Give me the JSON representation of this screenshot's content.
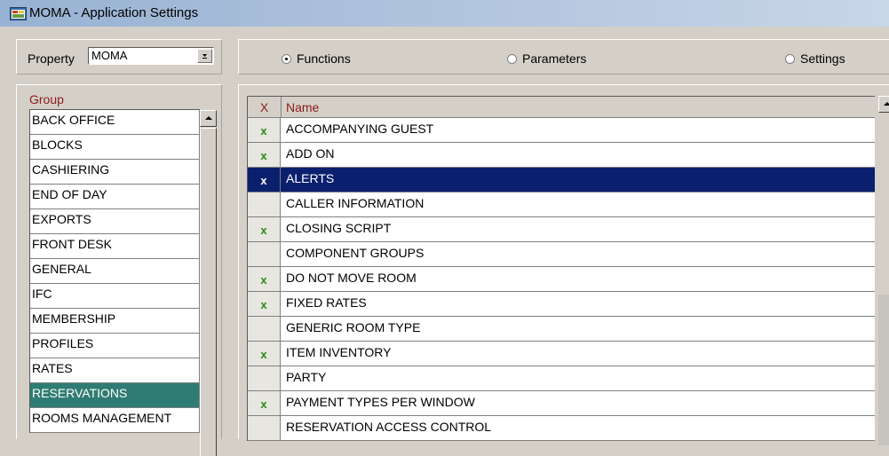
{
  "window": {
    "title": "MOMA - Application Settings",
    "icon": "app-window-icon"
  },
  "property": {
    "label": "Property",
    "value": "MOMA",
    "dropdown_icon": "dropdown-arrow-icon"
  },
  "modes": [
    {
      "label": "Functions",
      "selected": true
    },
    {
      "label": "Parameters",
      "selected": false
    },
    {
      "label": "Settings",
      "selected": false
    }
  ],
  "group": {
    "header": "Group",
    "items": [
      {
        "label": "BACK OFFICE",
        "selected": false
      },
      {
        "label": "BLOCKS",
        "selected": false
      },
      {
        "label": "CASHIERING",
        "selected": false
      },
      {
        "label": "END OF DAY",
        "selected": false
      },
      {
        "label": "EXPORTS",
        "selected": false
      },
      {
        "label": "FRONT DESK",
        "selected": false
      },
      {
        "label": "GENERAL",
        "selected": false
      },
      {
        "label": "IFC",
        "selected": false
      },
      {
        "label": "MEMBERSHIP",
        "selected": false
      },
      {
        "label": "PROFILES",
        "selected": false
      },
      {
        "label": "RATES",
        "selected": false
      },
      {
        "label": "RESERVATIONS",
        "selected": true
      },
      {
        "label": "ROOMS MANAGEMENT",
        "selected": false
      }
    ]
  },
  "functions": {
    "columns": {
      "x": "X",
      "name": "Name"
    },
    "rows": [
      {
        "active": "x",
        "name": "ACCOMPANYING GUEST",
        "selected": false
      },
      {
        "active": "x",
        "name": "ADD ON",
        "selected": false
      },
      {
        "active": "x",
        "name": "ALERTS",
        "selected": true
      },
      {
        "active": "",
        "name": "CALLER INFORMATION",
        "selected": false
      },
      {
        "active": "x",
        "name": "CLOSING SCRIPT",
        "selected": false
      },
      {
        "active": "",
        "name": "COMPONENT GROUPS",
        "selected": false
      },
      {
        "active": "x",
        "name": "DO NOT MOVE ROOM",
        "selected": false
      },
      {
        "active": "x",
        "name": "FIXED RATES",
        "selected": false
      },
      {
        "active": "",
        "name": "GENERIC ROOM TYPE",
        "selected": false
      },
      {
        "active": "x",
        "name": "ITEM INVENTORY",
        "selected": false
      },
      {
        "active": "",
        "name": "PARTY",
        "selected": false
      },
      {
        "active": "x",
        "name": "PAYMENT TYPES PER WINDOW",
        "selected": false
      },
      {
        "active": "",
        "name": "RESERVATION ACCESS CONTROL",
        "selected": false
      }
    ]
  },
  "colors": {
    "group_selected": "#2f7c74",
    "row_selected": "#0a1f6e",
    "check": "#2a8a1a",
    "header_text": "#8b1a1a"
  }
}
